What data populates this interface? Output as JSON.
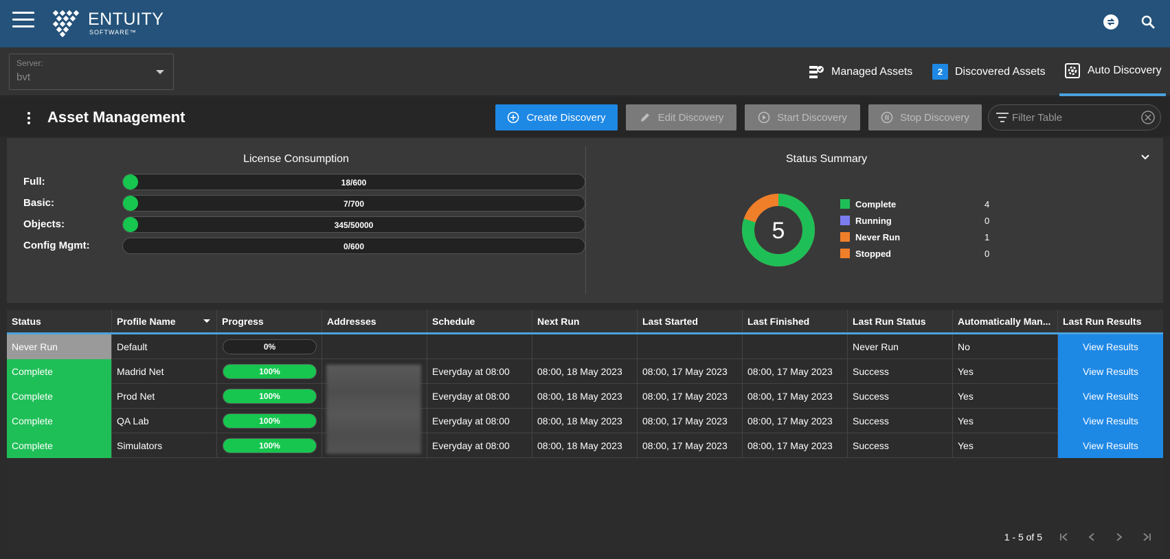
{
  "app": {
    "logo_main": "ENTUITY",
    "logo_sub": "SOFTWARE™",
    "icons": [
      "menu-icon",
      "sync-icon",
      "search-icon"
    ]
  },
  "server": {
    "label": "Server:",
    "value": "bvt"
  },
  "nav": {
    "managed_assets": "Managed Assets",
    "discovered_badge": "2",
    "discovered_assets": "Discovered Assets",
    "auto_discovery": "Auto Discovery"
  },
  "header": {
    "title": "Asset Management",
    "create": "Create Discovery",
    "edit": "Edit Discovery",
    "start": "Start Discovery",
    "stop": "Stop Discovery",
    "filter_placeholder": "Filter Table"
  },
  "license": {
    "title": "License Consumption",
    "rows": [
      {
        "label": "Full:",
        "value": "18/600",
        "fraction": 0.03
      },
      {
        "label": "Basic:",
        "value": "7/700",
        "fraction": 0.01
      },
      {
        "label": "Objects:",
        "value": "345/50000",
        "fraction": 0.0069
      },
      {
        "label": "Config Mgmt:",
        "value": "0/600",
        "fraction": 0
      }
    ]
  },
  "status_summary": {
    "title": "Status Summary",
    "total": "5",
    "items": [
      {
        "label": "Complete",
        "count": "4",
        "color": "#1fbf57"
      },
      {
        "label": "Running",
        "count": "0",
        "color": "#7b7bf0"
      },
      {
        "label": "Never Run",
        "count": "1",
        "color": "#f07f2a"
      },
      {
        "label": "Stopped",
        "count": "0",
        "color": "#f07f2a"
      }
    ]
  },
  "table": {
    "columns": [
      "Status",
      "Profile Name",
      "Progress",
      "Addresses",
      "Schedule",
      "Next Run",
      "Last Started",
      "Last Finished",
      "Last Run Status",
      "Automatically Man...",
      "Last Run Results"
    ],
    "rows": [
      {
        "status": "Never Run",
        "profile": "Default",
        "progress": "0%",
        "schedule": "",
        "next_run": "",
        "last_started": "",
        "last_finished": "",
        "last_run_status": "Never Run",
        "auto": "No",
        "results": "View Results"
      },
      {
        "status": "Complete",
        "profile": "Madrid Net",
        "progress": "100%",
        "schedule": "Everyday at 08:00",
        "next_run": "08:00, 18 May 2023",
        "last_started": "08:00, 17 May 2023",
        "last_finished": "08:00, 17 May 2023",
        "last_run_status": "Success",
        "auto": "Yes",
        "results": "View Results"
      },
      {
        "status": "Complete",
        "profile": "Prod Net",
        "progress": "100%",
        "schedule": "Everyday at 08:00",
        "next_run": "08:00, 18 May 2023",
        "last_started": "08:00, 17 May 2023",
        "last_finished": "08:00, 17 May 2023",
        "last_run_status": "Success",
        "auto": "Yes",
        "results": "View Results"
      },
      {
        "status": "Complete",
        "profile": "QA Lab",
        "progress": "100%",
        "schedule": "Everyday at 08:00",
        "next_run": "08:00, 18 May 2023",
        "last_started": "08:00, 17 May 2023",
        "last_finished": "08:00, 17 May 2023",
        "last_run_status": "Success",
        "auto": "Yes",
        "results": "View Results"
      },
      {
        "status": "Complete",
        "profile": "Simulators",
        "progress": "100%",
        "schedule": "Everyday at 08:00",
        "next_run": "08:00, 18 May 2023",
        "last_started": "08:00, 17 May 2023",
        "last_finished": "08:00, 17 May 2023",
        "last_run_status": "Success",
        "auto": "Yes",
        "results": "View Results"
      }
    ]
  },
  "pager": {
    "range": "1 - 5 of 5"
  }
}
